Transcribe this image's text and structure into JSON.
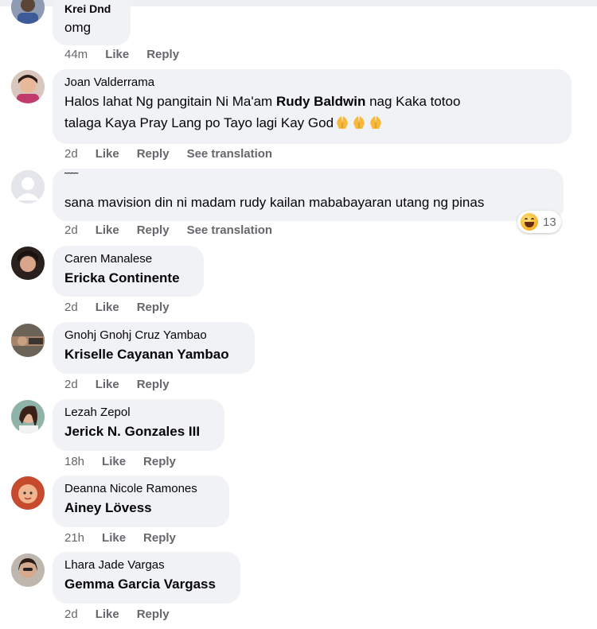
{
  "comments": [
    {
      "author": "Krei Dnd",
      "text": "omg",
      "time": "44m",
      "like": "Like",
      "reply": "Reply",
      "avatar_icon": "profile-photo-icon"
    },
    {
      "author": "Joan Valderrama",
      "line1_a": "Halos lahat Ng pangitain Ni Ma'am ",
      "line1_b": "Rudy Baldwin",
      "line1_c": " nag Kaka totoo",
      "line2": "talaga Kaya Pray Lang po Tayo lagi Kay God",
      "emoji": "folded-hands-icon",
      "time": "2d",
      "like": "Like",
      "reply": "Reply",
      "translate": "See translation"
    },
    {
      "author": "˜˜˜˜",
      "text": "sana mavision din ni madam rudy kailan mababayaran utang ng pinas",
      "time": "2d",
      "like": "Like",
      "reply": "Reply",
      "translate": "See translation",
      "reaction_count": "13",
      "reaction_icon": "grinning-squint-face-icon"
    },
    {
      "author": "Caren Manalese",
      "text": "Ericka Continente",
      "time": "2d",
      "like": "Like",
      "reply": "Reply"
    },
    {
      "author": "Gnohj Gnohj Cruz Yambao",
      "text": "Kriselle Cayanan Yambao",
      "time": "2d",
      "like": "Like",
      "reply": "Reply"
    },
    {
      "author": "Lezah Zepol",
      "text": "Jerick N. Gonzales III",
      "time": "18h",
      "like": "Like",
      "reply": "Reply"
    },
    {
      "author": "Deanna Nicole Ramones",
      "text": "Ainey Lövess",
      "time": "21h",
      "like": "Like",
      "reply": "Reply"
    },
    {
      "author": "Lhara Jade Vargas",
      "text": "Gemma Garcia Vargass",
      "time": "2d",
      "like": "Like",
      "reply": "Reply"
    }
  ],
  "colors": {
    "bubble": "#f0f2f5",
    "meta": "#65676b",
    "text": "#050505"
  }
}
